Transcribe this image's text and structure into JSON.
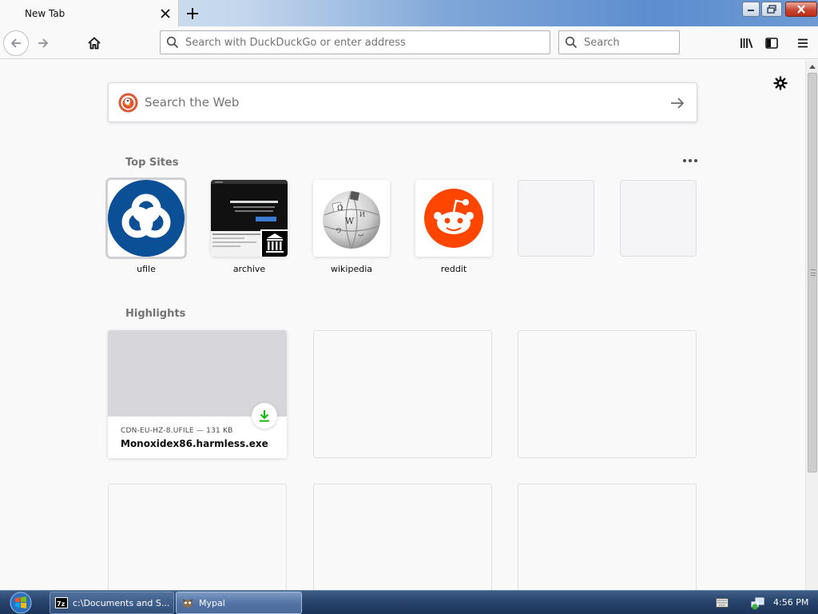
{
  "window": {
    "tab_title": "New Tab",
    "tab_close_icon": "close-icon",
    "new_tab_icon": "plus-icon"
  },
  "toolbar": {
    "url_placeholder": "Search with DuckDuckGo or enter address",
    "search_placeholder": "Search"
  },
  "newtab": {
    "web_search_placeholder": "Search the Web",
    "top_sites_title": "Top Sites",
    "highlights_title": "Highlights",
    "top_sites": [
      {
        "label": "ufile"
      },
      {
        "label": "archive"
      },
      {
        "label": "wikipedia"
      },
      {
        "label": "reddit"
      },
      {
        "label": ""
      },
      {
        "label": ""
      }
    ],
    "highlights": [
      {
        "host": "CDN-EU-HZ-8.UFILE — 131 KB",
        "title": "Monoxidex86.harmless.exe"
      }
    ]
  },
  "taskbar": {
    "tasks": [
      {
        "label": "c:\\Documents and S..."
      },
      {
        "label": "Mypal"
      }
    ],
    "clock": "4:56 PM"
  },
  "colors": {
    "ufile_blue": "#0b4f96",
    "reddit_orange": "#ff4500",
    "download_green": "#12bc00",
    "ddg_orange": "#de5833"
  }
}
